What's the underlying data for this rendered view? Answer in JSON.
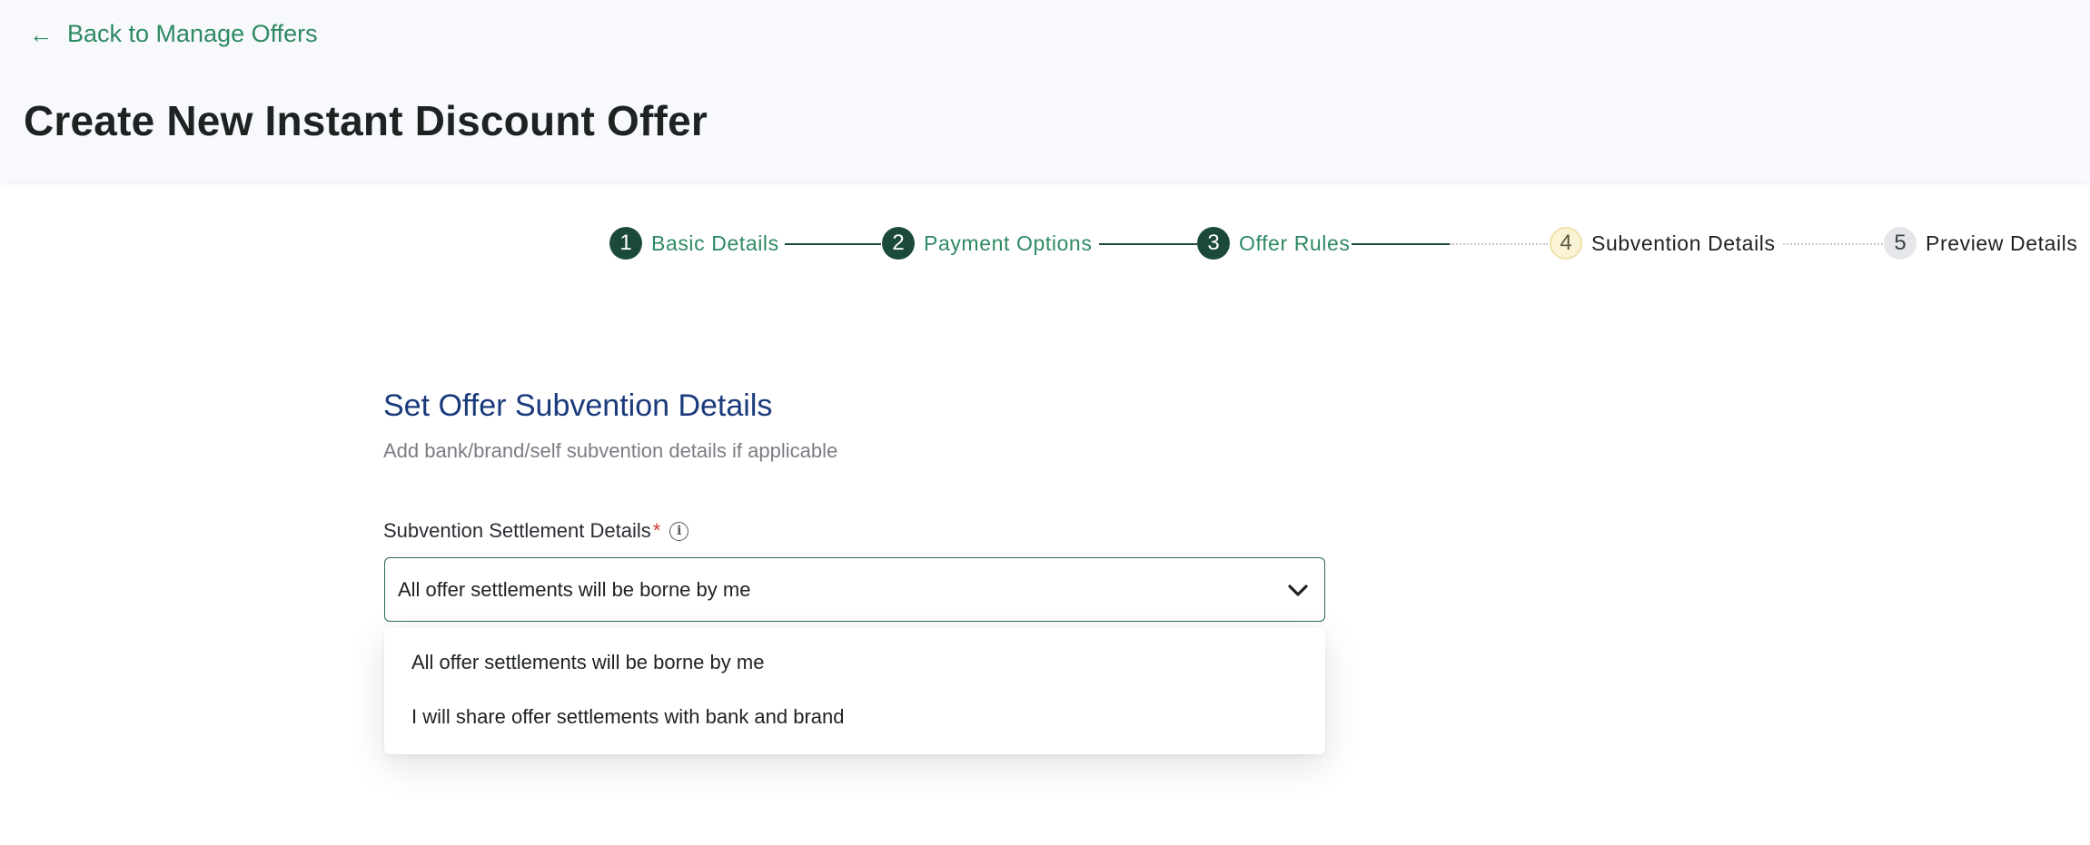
{
  "header": {
    "back_label": "Back to Manage Offers",
    "title": "Create New Instant Discount Offer"
  },
  "stepper": {
    "steps": [
      {
        "number": "1",
        "label": "Basic Details",
        "state": "done"
      },
      {
        "number": "2",
        "label": "Payment Options",
        "state": "done"
      },
      {
        "number": "3",
        "label": "Offer Rules",
        "state": "done"
      },
      {
        "number": "4",
        "label": "Subvention Details",
        "state": "current"
      },
      {
        "number": "5",
        "label": "Preview Details",
        "state": "todo"
      }
    ]
  },
  "content": {
    "title": "Set Offer Subvention Details",
    "subtitle": "Add bank/brand/self subvention details if applicable",
    "field": {
      "label": "Subvention Settlement Details",
      "required_mark": "*",
      "selected_value": "All offer settlements will be borne by me",
      "options": [
        "All offer settlements will be borne by me",
        "I will share offer settlements with bank and brand"
      ]
    }
  },
  "colors": {
    "brand_green": "#2e8a63",
    "step_done": "#1c4a3a",
    "section_title": "#1b3a7c",
    "required": "#d23b3b"
  },
  "icons": {
    "back": "arrow-left-icon",
    "info": "info-icon",
    "dropdown": "chevron-down-icon"
  }
}
